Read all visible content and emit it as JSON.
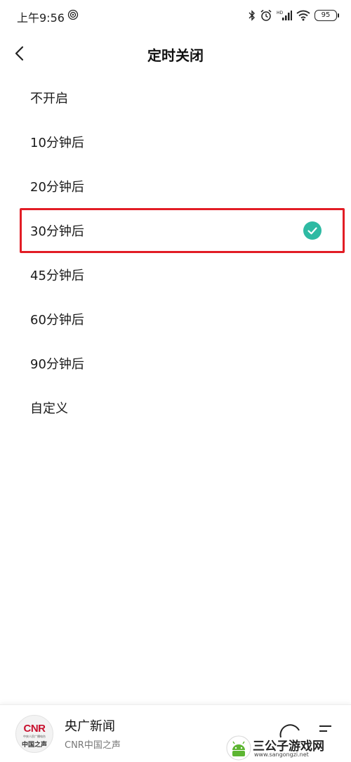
{
  "status_bar": {
    "time": "上午9:56",
    "battery": "95",
    "icons": [
      "hotspot-icon",
      "bluetooth-icon",
      "alarm-icon",
      "hd-signal-icon",
      "wifi-icon",
      "battery-icon"
    ]
  },
  "header": {
    "title": "定时关闭",
    "back_icon": "chevron-left-icon"
  },
  "options": [
    {
      "label": "不开启",
      "selected": false
    },
    {
      "label": "10分钟后",
      "selected": false
    },
    {
      "label": "20分钟后",
      "selected": false
    },
    {
      "label": "30分钟后",
      "selected": true
    },
    {
      "label": "45分钟后",
      "selected": false
    },
    {
      "label": "60分钟后",
      "selected": false
    },
    {
      "label": "90分钟后",
      "selected": false
    },
    {
      "label": "自定义",
      "selected": false
    }
  ],
  "player": {
    "logo_top": "CNR",
    "logo_sub": "中央人民广播电台",
    "logo_bottom": "中国之声",
    "station_name": "央广新闻",
    "station_sub": "CNR中国之声"
  },
  "watermark": {
    "name": "三公子游戏网",
    "url": "www.sangongzi.net"
  },
  "colors": {
    "accent": "#2ebaa3",
    "highlight": "#e21d25"
  }
}
